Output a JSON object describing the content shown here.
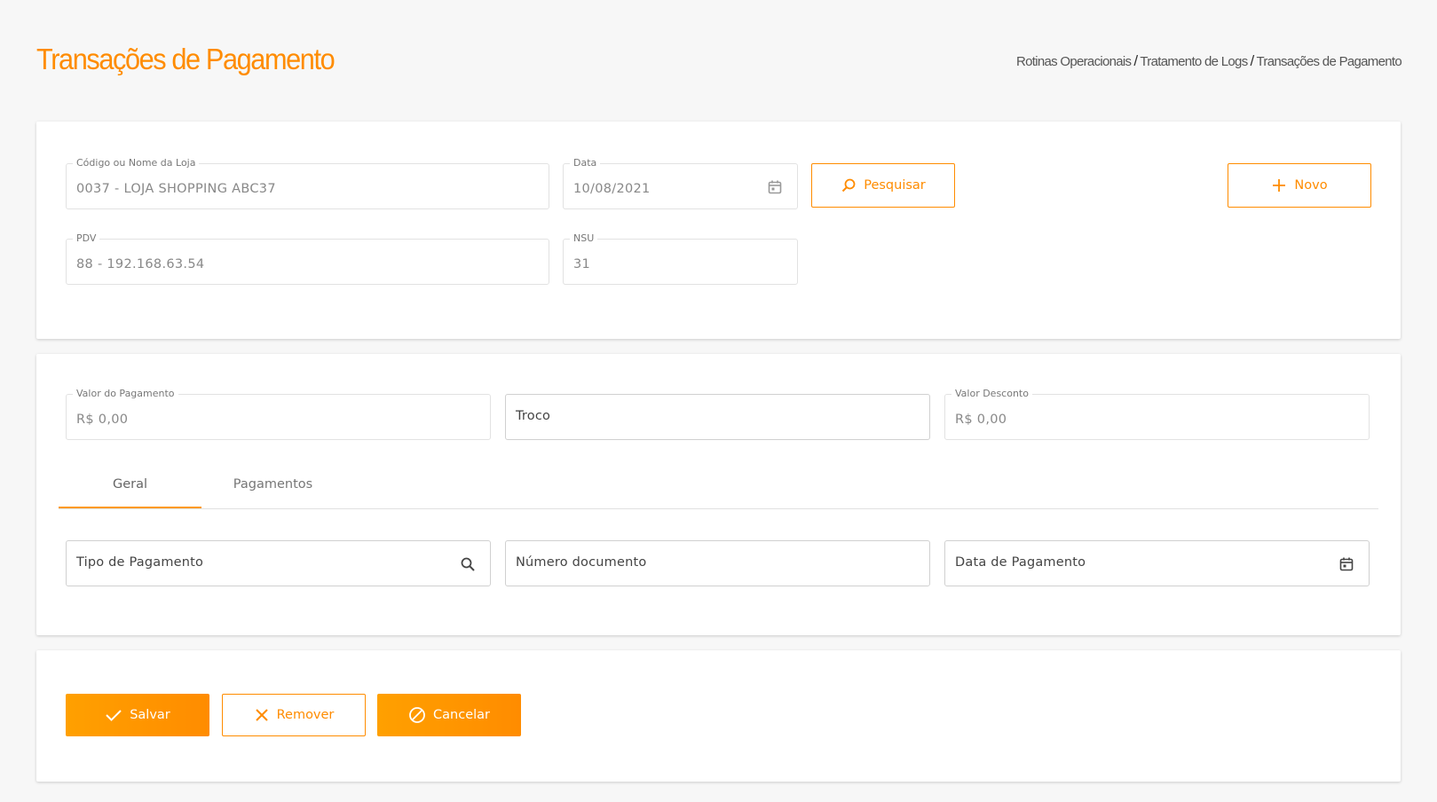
{
  "header": {
    "title": "Transações de Pagamento",
    "breadcrumb": [
      "Rotinas Operacionais",
      "Tratamento de Logs",
      "Transações de Pagamento"
    ],
    "breadcrumb_separator": "/"
  },
  "filters": {
    "loja": {
      "label": "Código ou Nome da Loja",
      "value": "0037 - LOJA SHOPPING ABC37"
    },
    "data": {
      "label": "Data",
      "value": "10/08/2021",
      "icon": "calendar-icon"
    },
    "pdv": {
      "label": "PDV",
      "value": "88 - 192.168.63.54"
    },
    "nsu": {
      "label": "NSU",
      "value": "31"
    },
    "search_button": {
      "label": "Pesquisar",
      "icon": "search-icon"
    },
    "new_button": {
      "label": "Novo",
      "icon": "plus-icon"
    }
  },
  "payment": {
    "valor_pagamento": {
      "label": "Valor do Pagamento",
      "value": "R$ 0,00"
    },
    "troco": {
      "placeholder": "Troco"
    },
    "valor_desconto": {
      "label": "Valor Desconto",
      "value": "R$ 0,00"
    },
    "tabs": [
      {
        "label": "Geral",
        "active": true
      },
      {
        "label": "Pagamentos",
        "active": false
      }
    ],
    "tipo_pagamento": {
      "placeholder": "Tipo de Pagamento",
      "icon": "search-icon"
    },
    "numero_documento": {
      "placeholder": "Número documento"
    },
    "data_pagamento": {
      "placeholder": "Data de Pagamento",
      "icon": "calendar-icon"
    }
  },
  "actions": {
    "save": {
      "label": "Salvar",
      "icon": "check-icon"
    },
    "remove": {
      "label": "Remover",
      "icon": "close-icon"
    },
    "cancel": {
      "label": "Cancelar",
      "icon": "cancel-icon"
    }
  },
  "colors": {
    "accent": "#ff8c00",
    "accent_light": "#ffa000",
    "background": "#f7f7f7",
    "card": "#ffffff"
  }
}
